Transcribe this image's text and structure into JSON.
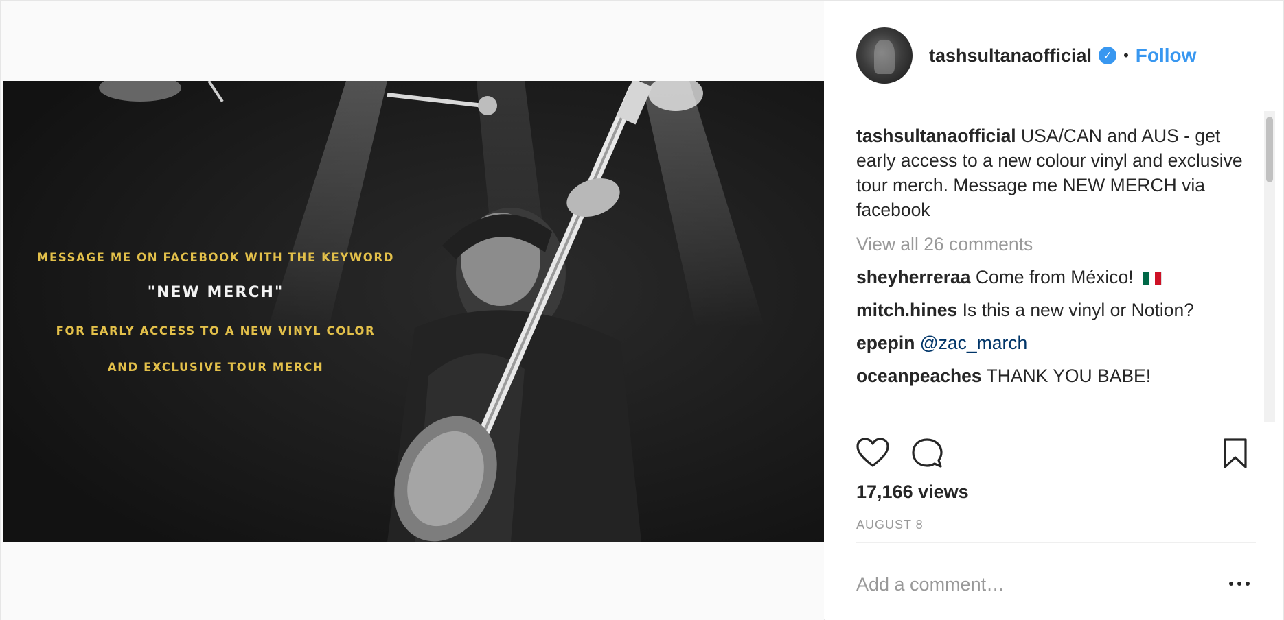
{
  "post": {
    "image_overlay": {
      "line1": "MESSAGE ME ON FACEBOOK WITH THE KEYWORD",
      "line2": "\"NEW MERCH\"",
      "line3": "FOR EARLY ACCESS TO A NEW VINYL COLOR",
      "line4": "AND EXCLUSIVE TOUR MERCH"
    }
  },
  "header": {
    "username": "tashsultanaofficial",
    "verified_mark": "✓",
    "separator": "•",
    "follow_label": "Follow"
  },
  "caption": {
    "username": "tashsultanaofficial",
    "text": "USA/CAN and AUS - get early access to a new colour vinyl and exclusive tour merch. Message me NEW MERCH via facebook"
  },
  "view_all_comments": "View all 26 comments",
  "comments": [
    {
      "username": "sheyherreraa",
      "text": "Come from México!"
    },
    {
      "username": "mitch.hines",
      "text": "Is this a new vinyl or Notion?"
    },
    {
      "username": "epepin",
      "mention": "@zac_march"
    },
    {
      "username": "oceanpeaches",
      "text": "THANK YOU BABE!"
    }
  ],
  "stats": {
    "views": "17,166 views",
    "date": "AUGUST 8"
  },
  "add_comment": {
    "placeholder": "Add a comment…"
  },
  "icons": {
    "like": "heart-icon",
    "comment": "comment-bubble-icon",
    "save": "bookmark-icon",
    "more": "more-options-icon",
    "verified": "verified-badge-icon"
  },
  "colors": {
    "accent": "#3897f0",
    "overlay_text": "#e3c04a",
    "secondary_text": "#999999",
    "mention": "#003569"
  }
}
